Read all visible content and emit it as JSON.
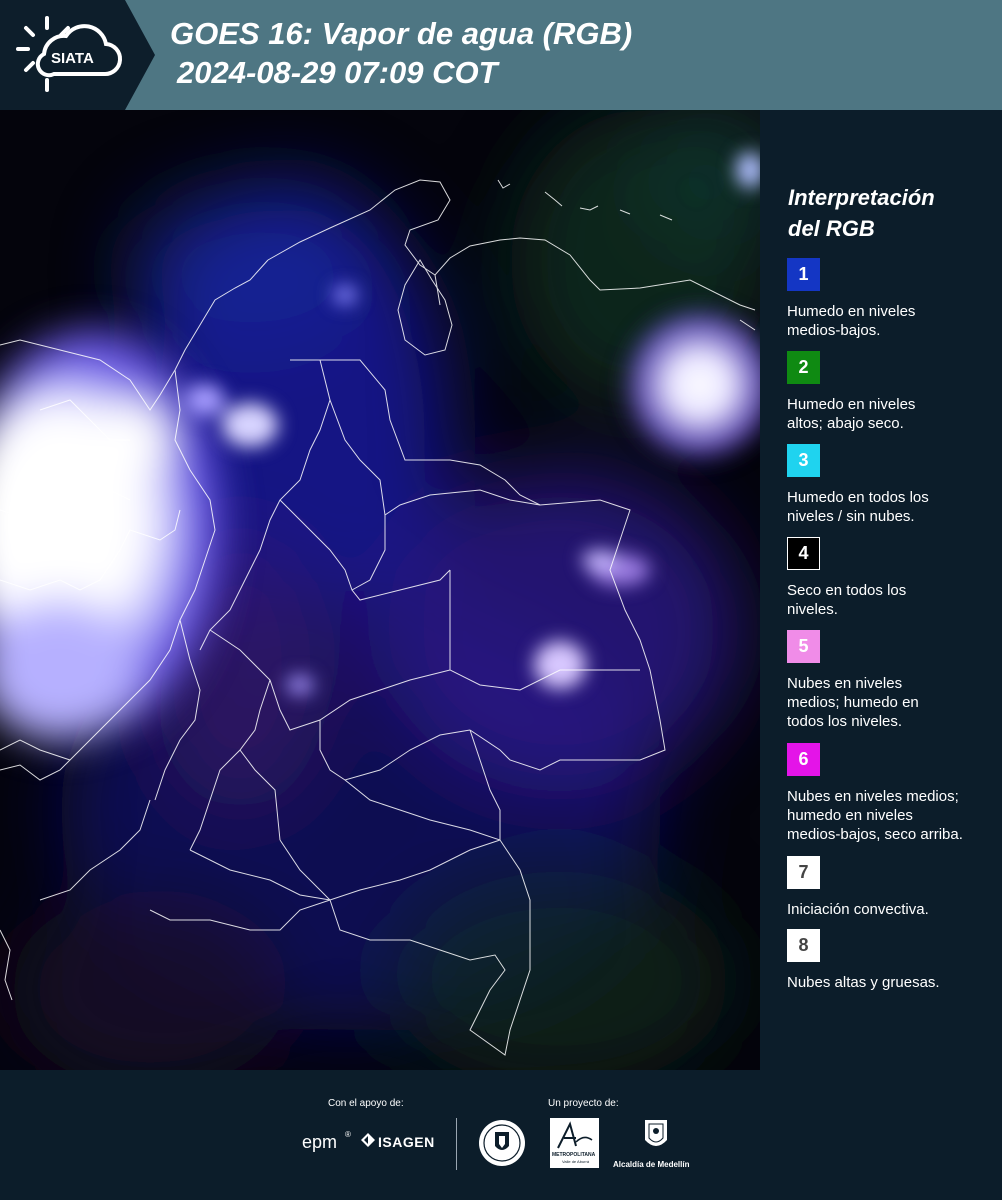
{
  "header": {
    "title_line1": "GOES 16: Vapor de agua (RGB)",
    "title_line2": "2024-08-29 07:09 COT",
    "logo_text": "SIATA"
  },
  "colors": {
    "header_bar": "#4e7683",
    "background": "#0d1e2b",
    "map_background": "#03030b",
    "boundary_lines": "#ffffff"
  },
  "legend": {
    "title_line1": "Interpretación",
    "title_line2": "del RGB",
    "items": [
      {
        "number": "1",
        "color": "#1436c4",
        "text_color": "#ffffff",
        "desc_line1": "Humedo en niveles",
        "desc_line2": "medios-bajos.",
        "desc_line3": ""
      },
      {
        "number": "2",
        "color": "#0f8a12",
        "text_color": "#ffffff",
        "desc_line1": "Humedo en niveles",
        "desc_line2": "altos; abajo seco.",
        "desc_line3": ""
      },
      {
        "number": "3",
        "color": "#1fd3ef",
        "text_color": "#ffffff",
        "desc_line1": "Humedo en todos los",
        "desc_line2": "niveles / sin nubes.",
        "desc_line3": ""
      },
      {
        "number": "4",
        "color": "#000000",
        "text_color": "#ffffff",
        "desc_line1": "Seco en todos los",
        "desc_line2": "niveles.",
        "desc_line3": ""
      },
      {
        "number": "5",
        "color": "#f08ce8",
        "text_color": "#ffffff",
        "desc_line1": "Nubes en niveles",
        "desc_line2": "medios; humedo en",
        "desc_line3": "todos los niveles."
      },
      {
        "number": "6",
        "color": "#e414e8",
        "text_color": "#ffffff",
        "desc_line1": "Nubes en niveles medios;",
        "desc_line2": "humedo en niveles",
        "desc_line3": "medios-bajos, seco arriba."
      },
      {
        "number": "7",
        "color": "#ffffff",
        "text_color": "#444444",
        "desc_line1": "Iniciación convectiva.",
        "desc_line2": "",
        "desc_line3": ""
      },
      {
        "number": "8",
        "color": "#ffffff",
        "text_color": "#444444",
        "desc_line1": "Nubes altas y gruesas.",
        "desc_line2": "",
        "desc_line3": ""
      }
    ]
  },
  "footer": {
    "support_label": "Con el apoyo de:",
    "project_label": "Un proyecto de:",
    "sponsor_epm": "epm",
    "sponsor_isagen": "ISAGEN",
    "area_metropolitana_caption": "METROPOLITANA",
    "area_sub_caption": "Valle de Aburrá",
    "alcaldia_caption": "Alcaldía de Medellín"
  }
}
